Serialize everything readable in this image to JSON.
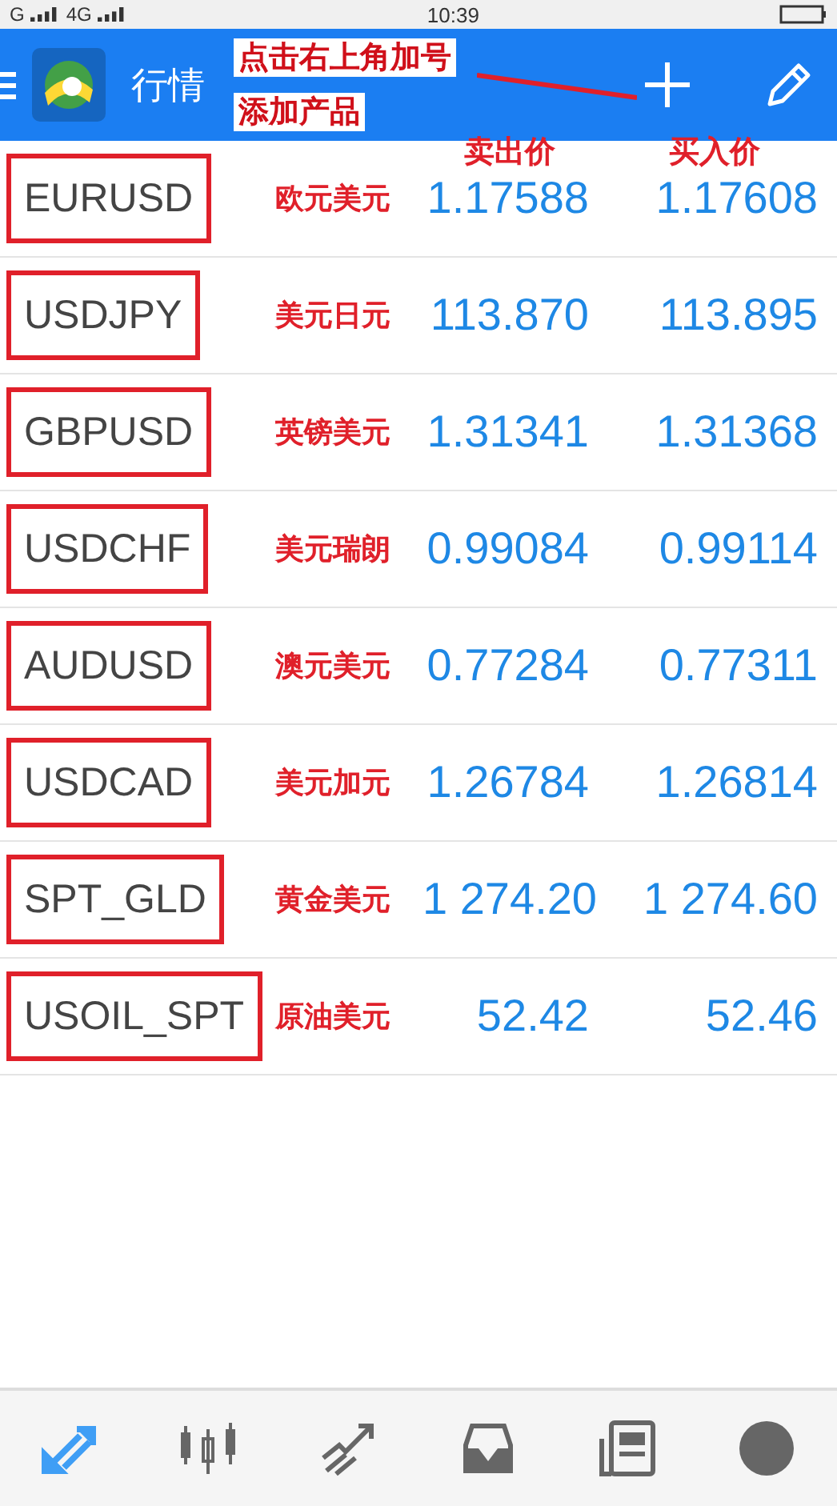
{
  "status_bar": {
    "carrier_1": "G",
    "carrier_2": "4G",
    "time": "10:39"
  },
  "header": {
    "title": "行情"
  },
  "annotation": {
    "line_1": "点击右上角加号",
    "line_2": "添加产品",
    "bid_label": "卖出价",
    "ask_label": "买入价"
  },
  "quotes": [
    {
      "symbol": "EURUSD",
      "note": "欧元美元",
      "bid": "1.17588",
      "ask": "1.17608"
    },
    {
      "symbol": "USDJPY",
      "note": "美元日元",
      "bid": "113.870",
      "ask": "113.895"
    },
    {
      "symbol": "GBPUSD",
      "note": "英镑美元",
      "bid": "1.31341",
      "ask": "1.31368"
    },
    {
      "symbol": "USDCHF",
      "note": "美元瑞朗",
      "bid": "0.99084",
      "ask": "0.99114"
    },
    {
      "symbol": "AUDUSD",
      "note": "澳元美元",
      "bid": "0.77284",
      "ask": "0.77311"
    },
    {
      "symbol": "USDCAD",
      "note": "美元加元",
      "bid": "1.26784",
      "ask": "1.26814"
    },
    {
      "symbol": "SPT_GLD",
      "note": "黄金美元",
      "bid": "1 274.20",
      "ask": "1 274.60"
    },
    {
      "symbol": "USOIL_SPT",
      "note": "原油美元",
      "bid": "52.42",
      "ask": "52.46"
    }
  ],
  "bottom_nav": [
    {
      "kind": "quotes",
      "selected": true
    },
    {
      "kind": "chart",
      "selected": false
    },
    {
      "kind": "trade",
      "selected": false
    },
    {
      "kind": "history",
      "selected": false
    },
    {
      "kind": "news",
      "selected": false
    },
    {
      "kind": "profile",
      "selected": false
    }
  ]
}
